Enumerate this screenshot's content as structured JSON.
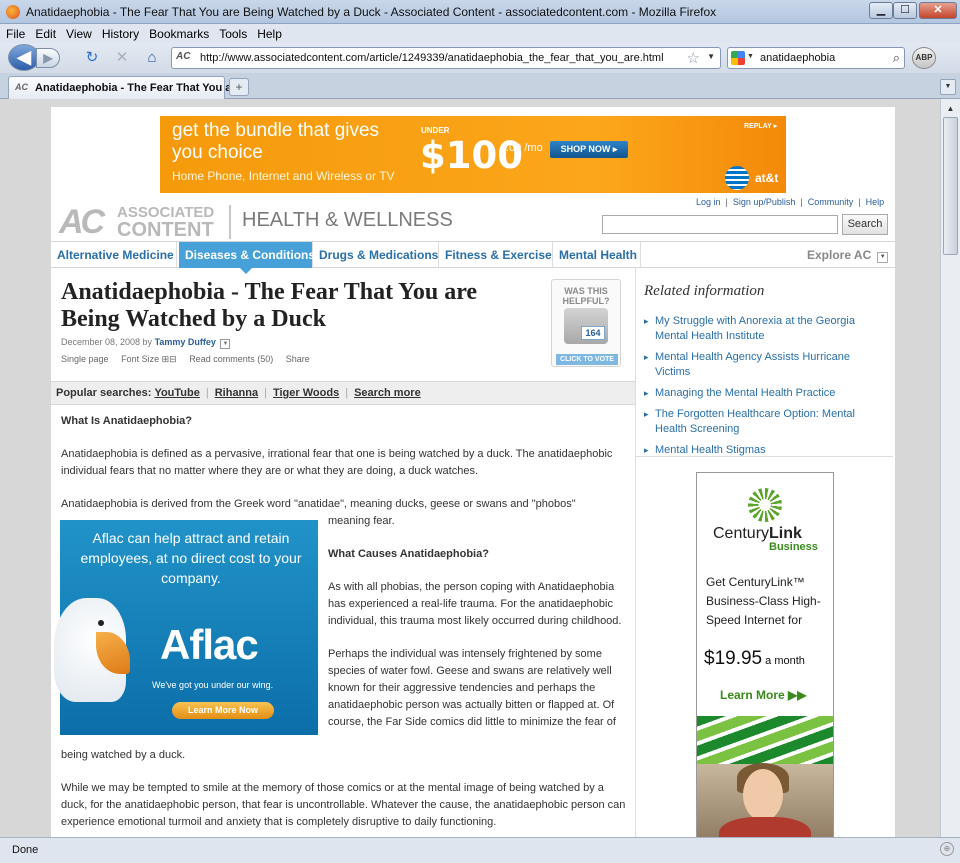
{
  "window": {
    "title": "Anatidaephobia - The Fear That You are Being Watched by a Duck - Associated Content - associatedcontent.com - Mozilla Firefox",
    "min": "▁",
    "max": "☐",
    "close": "✕"
  },
  "menu": [
    "File",
    "Edit",
    "View",
    "History",
    "Bookmarks",
    "Tools",
    "Help"
  ],
  "nav": {
    "back": "◀",
    "forward": "▶",
    "reload": "↻",
    "stop": "✕",
    "home": "⌂",
    "site_badge": "AC",
    "url": "http://www.associatedcontent.com/article/1249339/anatidaephobia_the_fear_that_you_are.html",
    "star": "☆",
    "url_drop": "▼",
    "search_engine_drop": "▼",
    "search_query": "anatidaephobia",
    "search_icon": "⌕",
    "abp": "ABP"
  },
  "tabs": [
    {
      "favicon": "AC",
      "title": "Anatidaephobia - The Fear That You a..."
    }
  ],
  "tab_controls": {
    "new_tab": "+",
    "list": "▼"
  },
  "status": {
    "text": "Done",
    "grip": "⊕"
  },
  "scrollbar": {
    "up": "▲"
  },
  "ad_banner": {
    "line1": "get the bundle that gives you choice",
    "line2": "Home Phone, Internet and Wireless or TV",
    "under": "UNDER",
    "price": "$100",
    "cents_mo": ".00 /mo",
    "shop": "SHOP NOW ▸",
    "replay": "REPLAY ▸",
    "brand": "at&t"
  },
  "site": {
    "logo_ac": "AC",
    "logo_associated": "ASSOCIATED",
    "logo_content": "CONTENT",
    "section": "HEALTH & WELLNESS",
    "top_links": [
      "Log in",
      "Sign up/Publish",
      "Community",
      "Help"
    ],
    "search_button": "Search"
  },
  "categories": [
    {
      "label": "Alternative Medicine",
      "active": false
    },
    {
      "label": "Diseases & Conditions",
      "active": true
    },
    {
      "label": "Drugs & Medications",
      "active": false
    },
    {
      "label": "Fitness & Exercise",
      "active": false
    },
    {
      "label": "Mental Health",
      "active": false
    }
  ],
  "explore": "Explore AC",
  "explore_drop": "▼",
  "article": {
    "title": "Anatidaephobia - The Fear That You are Being Watched by a Duck",
    "date_by": "December 08, 2008 by",
    "author": "Tammy Duffey",
    "author_drop": "▼",
    "tools": [
      "Single page",
      "Font Size ⊞⊟",
      "Read comments (50)",
      "Share"
    ]
  },
  "helpful": {
    "heading": "WAS THIS HELPFUL?",
    "count": "164",
    "vote": "CLICK TO VOTE"
  },
  "popular": {
    "label": "Popular searches:",
    "items": [
      "YouTube",
      "Rihanna",
      "Tiger Woods",
      "Search more"
    ]
  },
  "body": {
    "h1": "What Is Anatidaephobia?",
    "p1": "Anatidaephobia is defined as a pervasive, irrational fear that one is being watched by a duck. The anatidaephobic individual fears that no matter where they are or what they are doing, a duck watches.",
    "p2": "Anatidaephobia is derived from the Greek word \"anatidae\", meaning ducks, geese or swans and \"phobos\"",
    "p2b": "meaning fear.",
    "h2": "What Causes Anatidaephobia?",
    "p3": "As with all phobias, the person coping with Anatidaephobia has experienced a real-life trauma. For the anatidaephobic individual, this trauma most likely occurred during childhood.",
    "p4": "Perhaps the individual was intensely frightened by some species of water fowl. Geese and swans are relatively well known for their aggressive tendencies and perhaps the anatidaephobic person was actually bitten or flapped at. Of course, the Far Side comics did little to minimize the fear of",
    "p4b": "being watched by a duck.",
    "p5": "While we may be tempted to smile at the memory of those comics or at the mental image of being watched by a duck, for the anatidaephobic person, that fear is uncontrollable. Whatever the cause, the anatidaephobic person can experience emotional turmoil and anxiety that is completely disruptive to daily functioning."
  },
  "aflac": {
    "headline": "Aflac can help attract and retain employees, at no direct cost to your company.",
    "logo": "Aflac",
    "tagline": "We've got you under our wing.",
    "cta": "Learn More Now"
  },
  "related": {
    "heading": "Related information",
    "items": [
      "My Struggle with Anorexia at the Georgia Mental Health Institute",
      "Mental Health Agency Assists Hurricane Victims",
      "Managing the Mental Health Practice",
      "The Forgotten Healthcare Option: Mental Health Screening",
      "Mental Health Stigmas"
    ]
  },
  "centurylink": {
    "name_plain": "Century",
    "name_bold": "Link",
    "business": "Business",
    "copy": "Get CenturyLink™ Business-Class High-Speed Internet for",
    "price": "$19.95",
    "per": " a month",
    "cta": "Learn More ▶▶"
  }
}
